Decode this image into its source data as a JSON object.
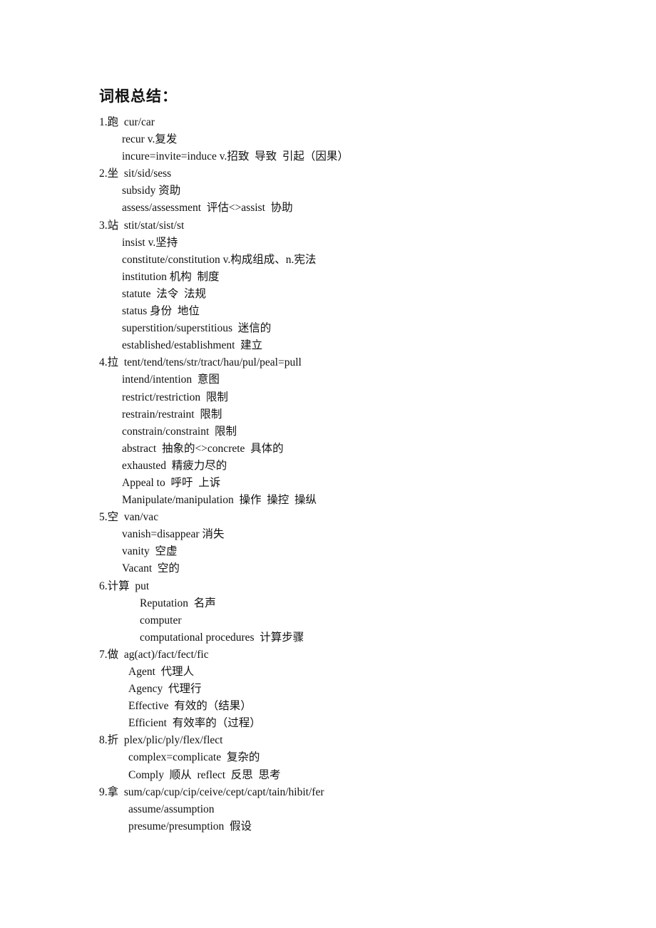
{
  "title": "词根总结：",
  "sections": [
    {
      "heading": "1.跑  cur/car",
      "indent": "ind1",
      "items": [
        "recur v.复发",
        "incure=invite=induce v.招致  导致  引起（因果）"
      ]
    },
    {
      "heading": "2.坐  sit/sid/sess",
      "indent": "ind1",
      "items": [
        "subsidy 资助",
        "assess/assessment  评估<>assist  协助"
      ]
    },
    {
      "heading": "3.站  stit/stat/sist/st",
      "indent": "ind1",
      "items": [
        "insist v.坚持",
        "constitute/constitution v.构成组成、n.宪法",
        "institution 机构  制度",
        "statute  法令  法规",
        "status 身份  地位",
        "superstition/superstitious  迷信的",
        "established/establishment  建立"
      ]
    },
    {
      "heading": "4.拉  tent/tend/tens/str/tract/hau/pul/peal=pull",
      "indent": "ind1",
      "items": [
        "intend/intention  意图",
        "restrict/restriction  限制",
        "restrain/restraint  限制",
        "constrain/constraint  限制",
        "abstract  抽象的<>concrete  具体的",
        "exhausted  精疲力尽的",
        "Appeal to  呼吁  上诉",
        "Manipulate/manipulation  操作  操控  操纵"
      ]
    },
    {
      "heading": "5.空  van/vac",
      "indent": "ind1",
      "items": [
        "vanish=disappear 消失",
        "vanity  空虚",
        "Vacant  空的"
      ]
    },
    {
      "heading": "6.计算  put",
      "indent": "ind2",
      "items": [
        "Reputation  名声",
        "computer",
        "computational procedures  计算步骤"
      ]
    },
    {
      "heading": "7.做  ag(act)/fact/fect/fic",
      "indent": "ind3",
      "items": [
        "Agent  代理人",
        "Agency  代理行",
        "Effective  有效的（结果）",
        "Efficient  有效率的（过程）"
      ]
    },
    {
      "heading": "8.折  plex/plic/ply/flex/flect",
      "indent": "ind3",
      "items": [
        "complex=complicate  复杂的",
        "Comply  顺从  reflect  反思  思考"
      ]
    },
    {
      "heading": "9.拿  sum/cap/cup/cip/ceive/cept/capt/tain/hibit/fer",
      "indent": "ind3",
      "items": [
        "assume/assumption",
        "presume/presumption  假设"
      ]
    }
  ]
}
